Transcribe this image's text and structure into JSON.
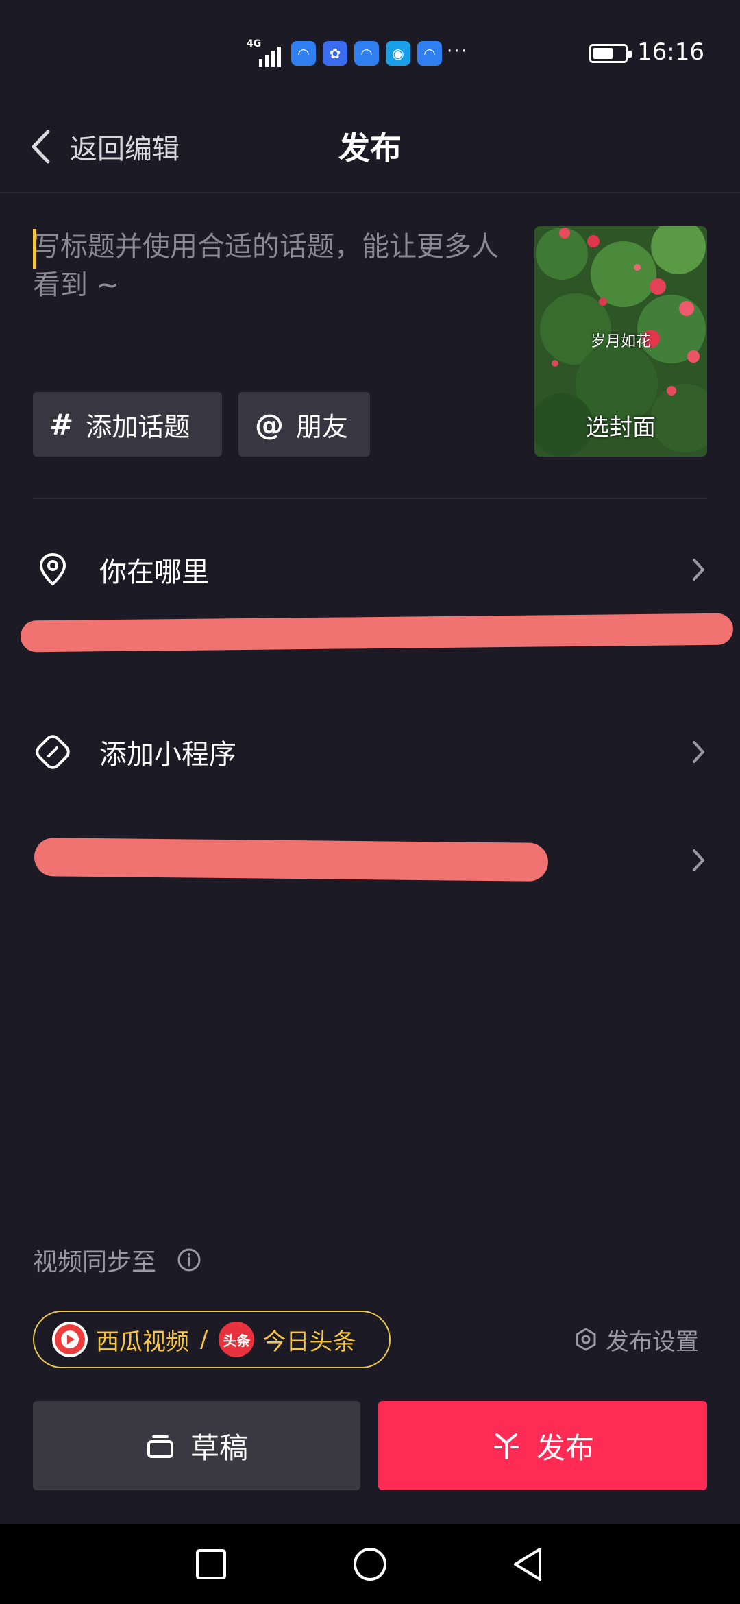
{
  "status_bar": {
    "network": "4G",
    "apps": [
      "app-icon",
      "baidu-icon",
      "app-icon",
      "browser-icon",
      "app-icon"
    ],
    "more": "···",
    "time": "16:16"
  },
  "header": {
    "back_label": "返回编辑",
    "title": "发布"
  },
  "caption": {
    "placeholder": "写标题并使用合适的话题，能让更多人看到 ~"
  },
  "chips": {
    "topic_symbol": "#",
    "topic_label": "添加话题",
    "friend_symbol": "@",
    "friend_label": "朋友"
  },
  "cover": {
    "caption": "岁月如花",
    "label": "选封面"
  },
  "rows": {
    "location_label": "你在哪里",
    "miniprogram_label": "添加小程序"
  },
  "sync": {
    "label": "视频同步至",
    "xigua_label": "西瓜视频",
    "separator": "/",
    "toutiao_logo": "头条",
    "toutiao_label": "今日头条"
  },
  "settings": {
    "label": "发布设置"
  },
  "actions": {
    "draft_label": "草稿",
    "publish_label": "发布"
  },
  "colors": {
    "background": "#1c1b25",
    "accent": "#fe2c55",
    "sync_accent": "#f5c543",
    "redaction": "#f07371"
  }
}
